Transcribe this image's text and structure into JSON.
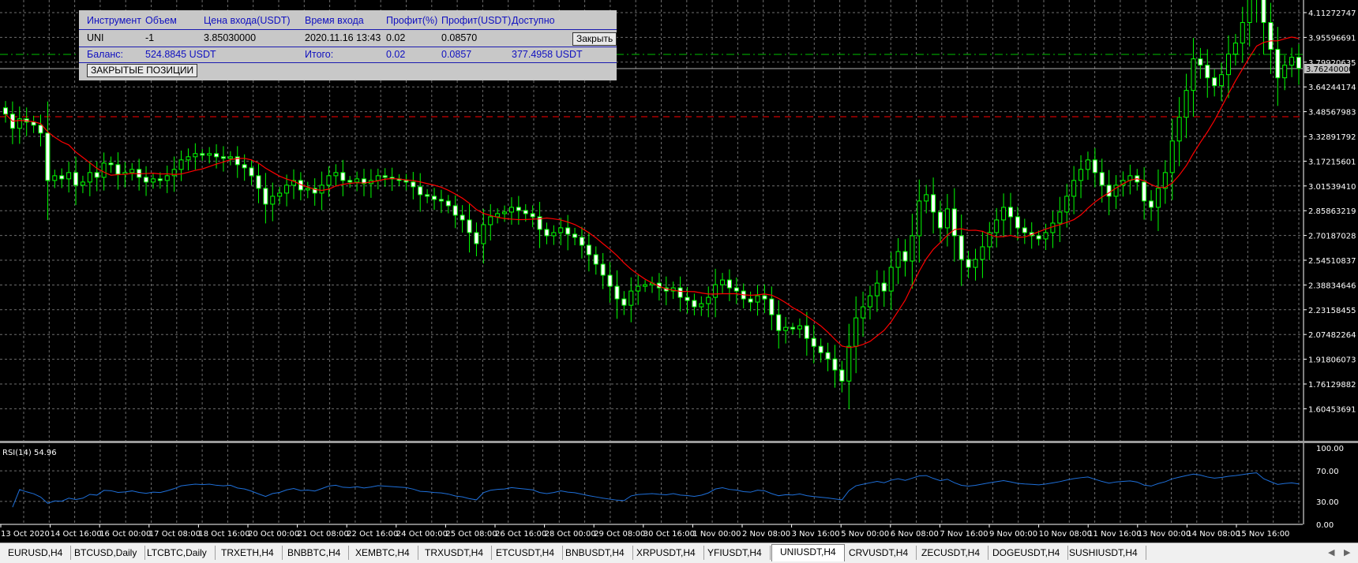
{
  "trade_panel": {
    "headers": [
      "Инструмент",
      "Объем",
      "Цена входа(USDT)",
      "Время входа",
      "Профит(%)",
      "Профит(USDT)",
      "Доступно"
    ],
    "position": {
      "instrument": "UNI",
      "volume": "-1",
      "entry_price": "3.85030000",
      "entry_time": "2020.11.16 13:43",
      "profit_pct": "0.02",
      "profit_usdt": "0.08570"
    },
    "close_button": "Закрыть",
    "balance_label": "Баланс:",
    "balance_value": "524.8845 USDT",
    "total_label": "Итого:",
    "total_pct": "0.02",
    "total_usdt": "0.0857",
    "available": "377.4958 USDT",
    "closed_positions_button": "ЗАКРЫТЫЕ ПОЗИЦИИ"
  },
  "price_axis": {
    "labels": [
      "4.11272747",
      "3.95596691",
      "3.79920635",
      "3.64244174",
      "3.48567983",
      "3.32891792",
      "3.17215601",
      "3.01539410",
      "2.85863219",
      "2.70187028",
      "2.54510837",
      "2.38834646",
      "2.23158455",
      "2.07482264",
      "1.91806073",
      "1.76129882",
      "1.60453691"
    ],
    "current_price": "3.76240000"
  },
  "rsi": {
    "label": "RSI(14) 54.96",
    "axis_labels": [
      "100.00",
      "70.00",
      "30.00",
      "0.00"
    ]
  },
  "time_axis": [
    "13 Oct 2020",
    "14 Oct 16:00",
    "16 Oct 00:00",
    "17 Oct 08:00",
    "18 Oct 16:00",
    "20 Oct 00:00",
    "21 Oct 08:00",
    "22 Oct 16:00",
    "24 Oct 00:00",
    "25 Oct 08:00",
    "26 Oct 16:00",
    "28 Oct 00:00",
    "29 Oct 08:00",
    "30 Oct 16:00",
    "1 Nov 00:00",
    "2 Nov 08:00",
    "3 Nov 16:00",
    "5 Nov 00:00",
    "6 Nov 08:00",
    "7 Nov 16:00",
    "9 Nov 00:00",
    "10 Nov 08:00",
    "11 Nov 16:00",
    "13 Nov 00:00",
    "14 Nov 08:00",
    "15 Nov 16:00"
  ],
  "tabs": [
    "EURUSD,H4",
    "BTCUSD,Daily",
    "LTCBTC,Daily",
    "TRXETH,H4",
    "BNBBTC,H4",
    "XEMBTC,H4",
    "TRXUSDT,H4",
    "ETCUSDT,H4",
    "BNBUSDT,H4",
    "XRPUSDT,H4",
    "YFIUSDT,H4",
    "UNIUSDT,H4",
    "CRVUSDT,H4",
    "ZECUSDT,H4",
    "DOGEUSDT,H4",
    "SUSHIUSDT,H4"
  ],
  "active_tab": "UNIUSDT,H4",
  "colors": {
    "bull": "#00ff00",
    "bear": "#ffffff",
    "ma": "#ff0000",
    "rsi": "#1e6fd9",
    "grid": "#6e6e6e"
  },
  "price_series_close": [
    3.47,
    3.38,
    3.44,
    3.42,
    3.4,
    3.35,
    3.05,
    3.08,
    3.06,
    3.1,
    3.02,
    3.04,
    3.1,
    3.07,
    3.16,
    3.15,
    3.09,
    3.1,
    3.12,
    3.07,
    3.04,
    3.06,
    3.05,
    3.08,
    3.12,
    3.18,
    3.2,
    3.22,
    3.21,
    3.22,
    3.2,
    3.19,
    3.2,
    3.15,
    3.13,
    3.08,
    3.0,
    2.9,
    2.95,
    2.97,
    3.02,
    3.05,
    2.99,
    3.0,
    2.97,
    3.02,
    3.08,
    3.1,
    3.05,
    3.04,
    3.06,
    3.03,
    3.05,
    3.08,
    3.07,
    3.06,
    3.05,
    3.04,
    3.01,
    2.96,
    2.95,
    2.93,
    2.92,
    2.89,
    2.83,
    2.8,
    2.72,
    2.65,
    2.77,
    2.82,
    2.84,
    2.85,
    2.88,
    2.86,
    2.84,
    2.82,
    2.74,
    2.7,
    2.72,
    2.75,
    2.71,
    2.69,
    2.64,
    2.58,
    2.52,
    2.45,
    2.38,
    2.3,
    2.26,
    2.35,
    2.38,
    2.39,
    2.4,
    2.37,
    2.35,
    2.37,
    2.31,
    2.29,
    2.25,
    2.27,
    2.31,
    2.39,
    2.42,
    2.37,
    2.35,
    2.3,
    2.28,
    2.32,
    2.3,
    2.2,
    2.1,
    2.12,
    2.11,
    2.13,
    2.05,
    2.0,
    1.96,
    1.92,
    1.85,
    1.78,
    2.0,
    2.18,
    2.25,
    2.32,
    2.4,
    2.35,
    2.5,
    2.6,
    2.54,
    2.7,
    2.92,
    2.96,
    2.85,
    2.75,
    2.87,
    2.7,
    2.55,
    2.5,
    2.55,
    2.63,
    2.72,
    2.8,
    2.88,
    2.82,
    2.75,
    2.72,
    2.7,
    2.68,
    2.72,
    2.78,
    2.85,
    2.95,
    3.05,
    3.12,
    3.18,
    3.1,
    3.02,
    2.95,
    3.02,
    3.05,
    3.08,
    3.04,
    2.92,
    2.88,
    3.0,
    3.1,
    3.3,
    3.45,
    3.62,
    3.82,
    3.78,
    3.7,
    3.65,
    3.72,
    3.85,
    3.92,
    4.05,
    4.2,
    4.32,
    4.05,
    3.88,
    3.7,
    3.78,
    3.83,
    3.76
  ]
}
